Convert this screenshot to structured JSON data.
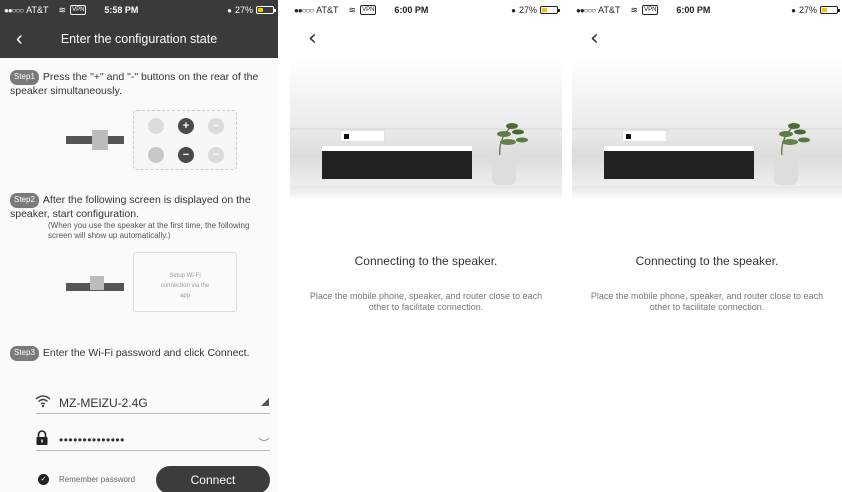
{
  "screens": [
    {
      "status": {
        "signal": "●●○○○",
        "carrier": "AT&T",
        "wifi": "≋",
        "vpn": "VPN",
        "time": "5:58 PM",
        "battery": "27%"
      },
      "nav": {
        "back": "‹",
        "title": "Enter the configuration state"
      },
      "steps": [
        {
          "badge": "Step1",
          "text": "Press the \"+\" and \"-\" buttons on the rear of the speaker simultaneously."
        },
        {
          "badge": "Step2",
          "text": "After the following screen is displayed on the speaker, start configuration.",
          "note": "(When you use the speaker at  the first time,  the following screen will show up automatically.)",
          "screen_text": "Setup Wi-Fi connection via the app"
        },
        {
          "badge": "Step3",
          "text": "Enter the Wi-Fi password and click Connect."
        }
      ],
      "form": {
        "ssid": "MZ-MEIZU-2.4G",
        "password": "••••••••••••••",
        "remember_label": "Remember password",
        "connect_label": "Connect"
      }
    },
    {
      "status": {
        "signal": "●●○○○",
        "carrier": "AT&T",
        "wifi": "≋",
        "vpn": "VPN",
        "time": "6:00 PM",
        "battery": "27%"
      },
      "back": "‹",
      "title": "Connecting to the speaker.",
      "desc": "Place the mobile phone, speaker, and router close to each other to facilitate connection."
    },
    {
      "status": {
        "signal": "●●○○○",
        "carrier": "AT&T",
        "wifi": "≋",
        "vpn": "VPN",
        "time": "6:00 PM",
        "battery": "27%"
      },
      "back": "‹",
      "title": "Connecting to the speaker.",
      "desc": "Place the mobile phone, speaker, and router close to each other to facilitate connection."
    }
  ],
  "icons": {
    "wifi": "wifi-icon",
    "lock": "lock-icon",
    "dropdown": "dropdown-triangle-icon",
    "eye": "eye-icon",
    "check": "check-icon"
  },
  "colors": {
    "dark_bar": "#3a3a3a",
    "button": "#3c3c3c",
    "battery": "#f0c400"
  }
}
